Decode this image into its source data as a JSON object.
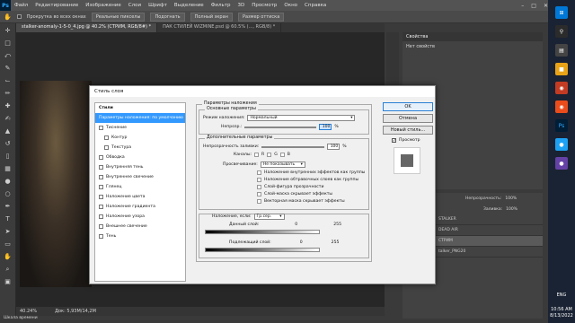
{
  "menubar": {
    "logo": "Ps",
    "items": [
      "Файл",
      "Редактирование",
      "Изображение",
      "Слои",
      "Шрифт",
      "Выделение",
      "Фильтр",
      "3D",
      "Просмотр",
      "Окно",
      "Справка"
    ]
  },
  "optbar": {
    "scroll_all": "Прокрутка во всех окнах",
    "real_pixels": "Реальные пикселы",
    "fit": "Подогнать",
    "full_screen": "Полный экран",
    "print_size": "Размер оттиска"
  },
  "tabs": [
    {
      "label": "stalker-anomaly-1-5-0_4.jpg @ 40.2% (СТРИМ, RGB/8#) *"
    },
    {
      "label": "ПАК СТИЛЕЙ WIZMINE.psd @ 60.5% (..., RGB/8) *"
    }
  ],
  "status": {
    "zoom": "40.24%",
    "doc": "Док: 5,93M/14,2M"
  },
  "timeline": "Шкала времени",
  "props": {
    "title": "Свойства",
    "subtitle": "Нет свойств"
  },
  "layers": {
    "opacity_label": "Непрозрачность:",
    "opacity_value": "100%",
    "fill_label": "Заливка:",
    "fill_value": "100%",
    "rows": [
      {
        "name": "STALKER",
        "selected": false
      },
      {
        "name": "DEAD AIR",
        "selected": false
      },
      {
        "name": "СТРИМ",
        "selected": true
      },
      {
        "name": "talker_PNG20",
        "selected": false
      }
    ]
  },
  "taskbar": {
    "lang": "ENG",
    "time": "10:56 AM",
    "date": "8/13/2022"
  },
  "dialog": {
    "title": "Стиль слоя",
    "styles_header": "Стили",
    "styles": [
      {
        "label": "Параметры наложения: по умолчанию",
        "selected": true,
        "check": false,
        "indent": false
      },
      {
        "label": "Тиснение",
        "selected": false,
        "check": true,
        "indent": false
      },
      {
        "label": "Контур",
        "selected": false,
        "check": true,
        "indent": true
      },
      {
        "label": "Текстура",
        "selected": false,
        "check": true,
        "indent": true
      },
      {
        "label": "Обводка",
        "selected": false,
        "check": true,
        "indent": false
      },
      {
        "label": "Внутренняя тень",
        "selected": false,
        "check": true,
        "indent": false
      },
      {
        "label": "Внутреннее свечение",
        "selected": false,
        "check": true,
        "indent": false
      },
      {
        "label": "Глянец",
        "selected": false,
        "check": true,
        "indent": false
      },
      {
        "label": "Наложение цвета",
        "selected": false,
        "check": true,
        "indent": false
      },
      {
        "label": "Наложение градиента",
        "selected": false,
        "check": true,
        "indent": false
      },
      {
        "label": "Наложение узора",
        "selected": false,
        "check": true,
        "indent": false
      },
      {
        "label": "Внешнее свечение",
        "selected": false,
        "check": true,
        "indent": false
      },
      {
        "label": "Тень",
        "selected": false,
        "check": true,
        "indent": false
      }
    ],
    "blend_title": "Параметры наложения",
    "basic_title": "Основные параметры",
    "blend_mode_label": "Режим наложения:",
    "blend_mode_value": "Нормальный",
    "opacity_label": "Непрозр.:",
    "opacity_value": "100",
    "percent": "%",
    "advanced_title": "Дополнительные параметры",
    "fill_opacity_label": "Непрозрачность заливки:",
    "fill_opacity_value": "100",
    "channels_label": "Каналы:",
    "channels": [
      "R",
      "G",
      "B"
    ],
    "knockout_label": "Просвечивание:",
    "knockout_value": "Не показывать",
    "options": [
      "Наложение внутренних эффектов как группы",
      "Наложение обтравочных слоев как группы",
      "Слой-фигура прозрачности",
      "Слой-маска скрывает эффекты",
      "Векторная маска скрывает эффекты"
    ],
    "blend_if_label": "Наложение, если:",
    "blend_if_value": "Гр.сер.",
    "this_layer_label": "Данный слой:",
    "this_layer_min": "0",
    "this_layer_max": "255",
    "underlying_label": "Подлежащий слой:",
    "underlying_min": "0",
    "underlying_max": "255",
    "ok": "OK",
    "cancel": "Отмена",
    "new_style": "Новый стиль...",
    "preview": "Просмотр"
  }
}
